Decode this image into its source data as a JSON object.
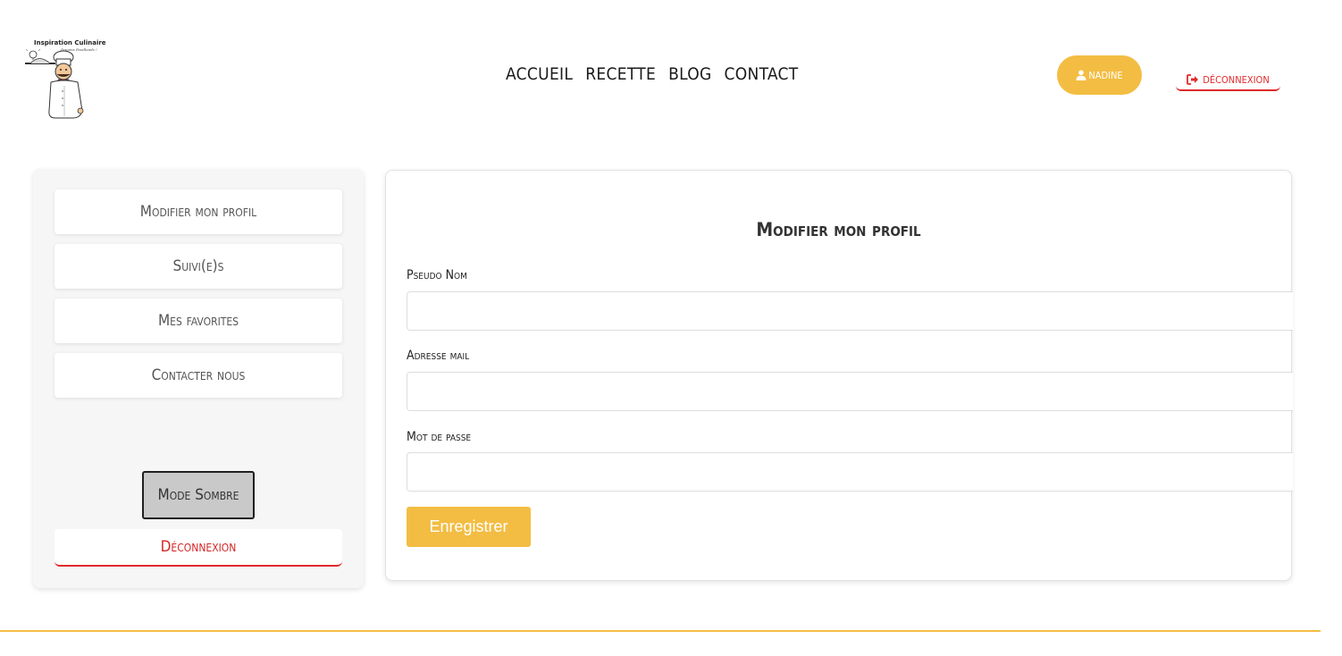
{
  "header": {
    "logo": {
      "title": "Inspiration Culinaire",
      "subtitle": "Dreams Foodlands !"
    },
    "nav": [
      "ACCUEIL",
      "RECETTE",
      "BLOG",
      "CONTACT"
    ],
    "user": {
      "name": "NADINE",
      "icon": "user-icon"
    },
    "logout": {
      "label": "DÉCONNEXION",
      "icon": "sign-out-icon"
    }
  },
  "sidebar": {
    "items": [
      "Modifier mon profil",
      "Suivi(e)s",
      "Mes favorites",
      "Contacter nous"
    ],
    "dark_mode_label": "Mode Sombre",
    "logout_label": "Déconnexion"
  },
  "profile_form": {
    "title": "Modifier mon profil",
    "fields": [
      {
        "label": "Pseudo Nom",
        "value": "",
        "placeholder": ""
      },
      {
        "label": "Adresse mail",
        "value": "",
        "placeholder": ""
      },
      {
        "label": "Mot de passe",
        "value": "",
        "placeholder": ""
      }
    ],
    "submit_label": "Enregistrer"
  },
  "colors": {
    "accent": "#f3bd43",
    "danger": "#e02b2b",
    "sidebar_bg": "#f6f6f6",
    "dark_mode_button": "#c9c9c9"
  }
}
